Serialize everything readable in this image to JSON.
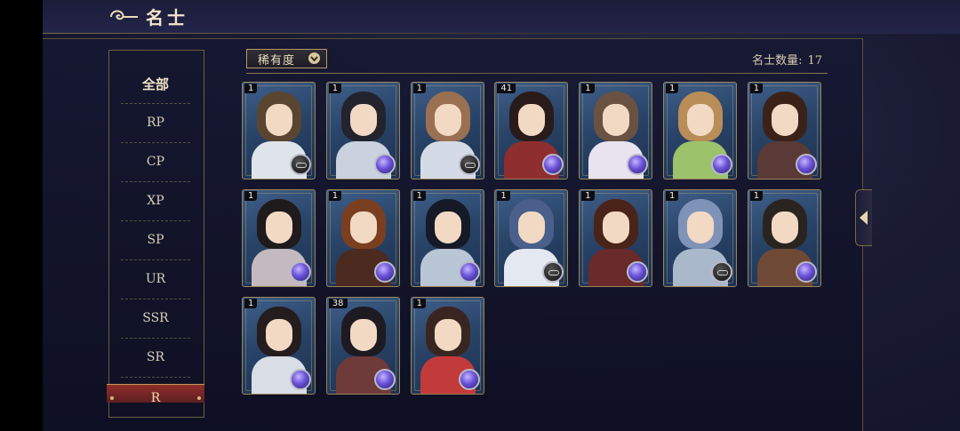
{
  "header": {
    "title": "名士"
  },
  "sidebar": {
    "items": [
      {
        "label": "全部"
      },
      {
        "label": "RP"
      },
      {
        "label": "CP"
      },
      {
        "label": "XP"
      },
      {
        "label": "SP"
      },
      {
        "label": "UR"
      },
      {
        "label": "SSR"
      },
      {
        "label": "SR"
      }
    ],
    "active": {
      "label": "R"
    }
  },
  "filter": {
    "label": "稀有度"
  },
  "count": {
    "label": "名士数量:",
    "value": "17"
  },
  "cards": [
    {
      "level": "1",
      "hair": "#5a4630",
      "body": "#dfe4ea",
      "badge": "dark"
    },
    {
      "level": "1",
      "hair": "#23232e",
      "body": "#c9d2de",
      "badge": "orb"
    },
    {
      "level": "1",
      "hair": "#9a7052",
      "body": "#d5dbe6",
      "badge": "dark"
    },
    {
      "level": "41",
      "hair": "#2a1b1b",
      "body": "#8e2e2e",
      "badge": "orb"
    },
    {
      "level": "1",
      "hair": "#6a5242",
      "body": "#e8e3ee",
      "badge": "orb"
    },
    {
      "level": "1",
      "hair": "#b98d58",
      "body": "#9cc26b",
      "badge": "orb"
    },
    {
      "level": "1",
      "hair": "#3b2218",
      "body": "#5a3a36",
      "badge": "orb"
    },
    {
      "level": "1",
      "hair": "#1f1a1c",
      "body": "#c4b9bf",
      "badge": "orb"
    },
    {
      "level": "1",
      "hair": "#7a3f20",
      "body": "#4c2a20",
      "badge": "orb"
    },
    {
      "level": "1",
      "hair": "#161a26",
      "body": "#b9c6d6",
      "badge": "orb"
    },
    {
      "level": "1",
      "hair": "#4a5f8a",
      "body": "#e4e8f0",
      "badge": "dark"
    },
    {
      "level": "1",
      "hair": "#4a2418",
      "body": "#6a2a2a",
      "badge": "orb"
    },
    {
      "level": "1",
      "hair": "#7f93b8",
      "body": "#aab8cc",
      "badge": "dark"
    },
    {
      "level": "1",
      "hair": "#2a2420",
      "body": "#6e4a36",
      "badge": "orb"
    },
    {
      "level": "1",
      "hair": "#251c1e",
      "body": "#d8dde6",
      "badge": "orb"
    },
    {
      "level": "38",
      "hair": "#1e1a22",
      "body": "#6e3a3a",
      "badge": "orb"
    },
    {
      "level": "1",
      "hair": "#3a2620",
      "body": "#c33a3a",
      "badge": "orb"
    }
  ]
}
